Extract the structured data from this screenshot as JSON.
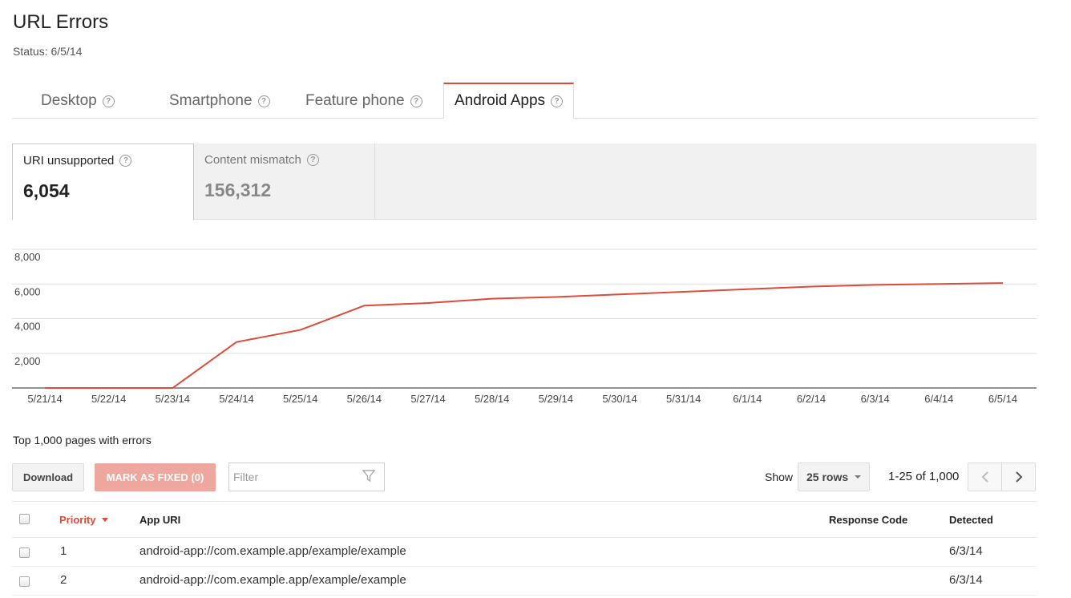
{
  "header": {
    "title": "URL Errors",
    "status": "Status: 6/5/14"
  },
  "tabs": [
    {
      "label": "Desktop",
      "active": false
    },
    {
      "label": "Smartphone",
      "active": false
    },
    {
      "label": "Feature phone",
      "active": false
    },
    {
      "label": "Android Apps",
      "active": true
    }
  ],
  "help_glyph": "?",
  "metrics": [
    {
      "label": "URI unsupported",
      "value": "6,054",
      "active": true
    },
    {
      "label": "Content mismatch",
      "value": "156,312",
      "active": false
    }
  ],
  "colors": {
    "accent": "#dd4b39",
    "mark_fixed_bg": "#eea79e"
  },
  "chart_data": {
    "type": "line",
    "x": [
      "5/21/14",
      "5/22/14",
      "5/23/14",
      "5/24/14",
      "5/25/14",
      "5/26/14",
      "5/27/14",
      "5/28/14",
      "5/29/14",
      "5/30/14",
      "5/31/14",
      "6/1/14",
      "6/2/14",
      "6/3/14",
      "6/4/14",
      "6/5/14"
    ],
    "series": [
      {
        "values": [
          0,
          0,
          0,
          2650,
          3350,
          4750,
          4900,
          5150,
          5250,
          5400,
          5550,
          5700,
          5850,
          5950,
          6000,
          6054
        ]
      }
    ],
    "yticks": [
      "8,000",
      "6,000",
      "4,000",
      "2,000"
    ],
    "ytick_values": [
      8000,
      6000,
      4000,
      2000
    ],
    "ylim": [
      0,
      8000
    ],
    "grid": true,
    "line_color": "#dd4b39"
  },
  "table": {
    "title": "Top 1,000 pages with errors",
    "download_label": "Download",
    "mark_fixed_label": "MARK AS FIXED (0)",
    "filter_placeholder": "Filter",
    "show_label": "Show",
    "rows_per_page": "25 rows",
    "pager_text": "1-25 of 1,000",
    "columns": {
      "priority": "Priority",
      "app_uri": "App URI",
      "response_code": "Response Code",
      "detected": "Detected"
    },
    "rows": [
      {
        "priority": "1",
        "app_uri": "android-app://com.example.app/example/example",
        "response_code": "",
        "detected": "6/3/14"
      },
      {
        "priority": "2",
        "app_uri": "android-app://com.example.app/example/example",
        "response_code": "",
        "detected": "6/3/14"
      }
    ]
  }
}
